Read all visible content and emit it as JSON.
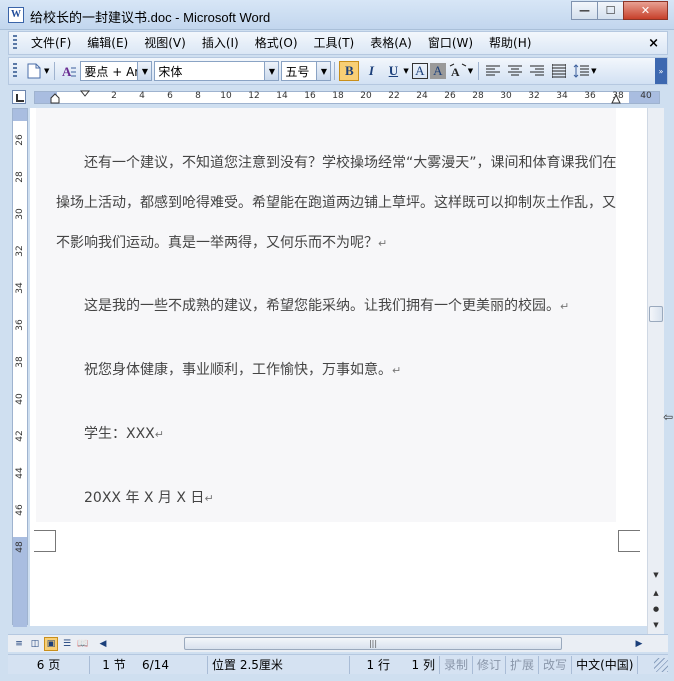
{
  "window": {
    "title": "给校长的一封建议书.doc - Microsoft Word",
    "app_icon": "word-doc-icon",
    "minimize": "—",
    "maximize": "☐",
    "close": "✕"
  },
  "menu": {
    "items": [
      "文件(F)",
      "编辑(E)",
      "视图(V)",
      "插入(I)",
      "格式(O)",
      "工具(T)",
      "表格(A)",
      "窗口(W)",
      "帮助(H)"
    ],
    "close_doc": "×"
  },
  "toolbar": {
    "style_value": "要点 + Aria",
    "font_value": "宋体",
    "size_value": "五号",
    "bold": "B",
    "italic": "I",
    "underline": "U",
    "char_border": "A",
    "char_shading": "A",
    "bold_active": true
  },
  "ruler": {
    "h_ticks": [
      "2",
      "4",
      "6",
      "8",
      "10",
      "12",
      "14",
      "16",
      "18",
      "20",
      "22",
      "24",
      "26",
      "28",
      "30",
      "32",
      "34",
      "36",
      "38",
      "40",
      "42",
      "44",
      "46",
      "48"
    ],
    "v_ticks": [
      "26",
      "28",
      "30",
      "32",
      "34",
      "36",
      "38",
      "40",
      "42",
      "44",
      "46",
      "48"
    ],
    "right_label": "48"
  },
  "document": {
    "paragraphs": [
      {
        "lines": [
          "还有一个建议，不知道您注意到没有？学校操场经常“大雾漫天”，课间和体育课我们在",
          "操场上活动，都感到呛得难受。希望能在跑道两边铺上草坪。这样既可以抑制灰土作乱，又",
          "不影响我们运动。真是一举两得，又何乐而不为呢？"
        ]
      },
      {
        "lines": [
          "这是我的一些不成熟的建议，希望您能采纳。让我们拥有一个更美丽的校园。"
        ]
      },
      {
        "lines": [
          "祝您身体健康，事业顺利，工作愉快，万事如意。"
        ]
      },
      {
        "lines": [
          "学生：XXX"
        ]
      },
      {
        "lines": [
          "20XX 年 X 月 X 日"
        ]
      }
    ],
    "para_mark": "↵"
  },
  "statusbar": {
    "page": "6 页",
    "section": "1 节",
    "page_of": "6/14",
    "position": "位置 2.5厘米",
    "line": "1 行",
    "column": "1 列",
    "rec": "录制",
    "trk": "修订",
    "ext": "扩展",
    "ovr": "改写",
    "language": "中文(中国)"
  },
  "hscroll": {
    "thumb_grip": "|||"
  },
  "colors": {
    "chrome": "#cfdff0",
    "active_button": "#f8cf75",
    "page_bg": "#f7f7f9",
    "text": "#444444"
  }
}
